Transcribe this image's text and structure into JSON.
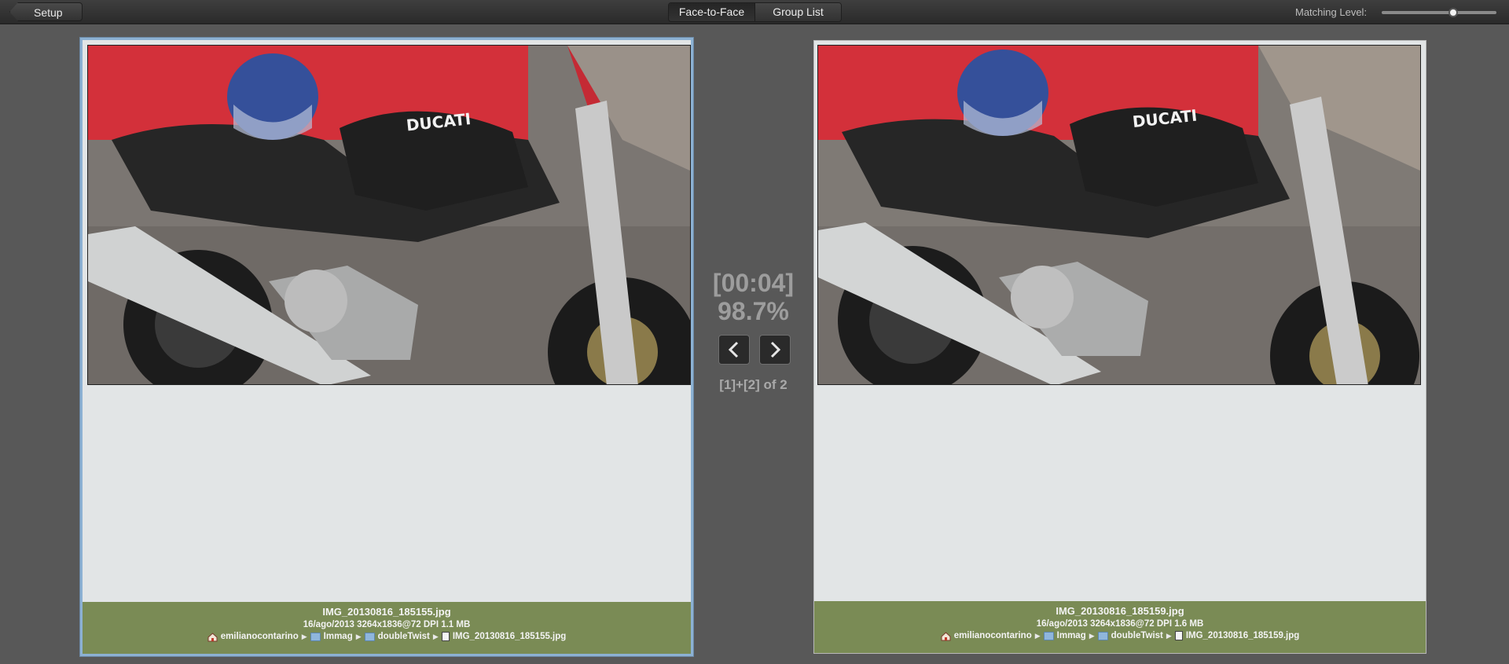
{
  "toolbar": {
    "back_label": "Setup",
    "tabs": [
      {
        "label": "Face-to-Face",
        "active": true
      },
      {
        "label": "Group List",
        "active": false
      }
    ],
    "matching_label": "Matching Level:",
    "matching_level": 0.62
  },
  "center": {
    "timer": "[00:04]",
    "similarity": "98.7%",
    "counter": "[1]+[2] of 2",
    "prev_icon": "chevron-left-icon",
    "next_icon": "chevron-right-icon"
  },
  "left": {
    "filename": "IMG_20130816_185155.jpg",
    "meta": "16/ago/2013  3264x1836@72 DPI  1.1 MB",
    "path": [
      "emilianocontarino",
      "Immag",
      "doubleTwist",
      "IMG_20130816_185155.jpg"
    ]
  },
  "right": {
    "filename": "IMG_20130816_185159.jpg",
    "meta": "16/ago/2013  3264x1836@72 DPI  1.6 MB",
    "path": [
      "emilianocontarino",
      "Immag",
      "doubleTwist",
      "IMG_20130816_185159.jpg"
    ]
  },
  "colors": {
    "info_bar": "#7a8b55",
    "selected_border": "#8cb1d3",
    "panel_bg": "#e2e5e6"
  }
}
